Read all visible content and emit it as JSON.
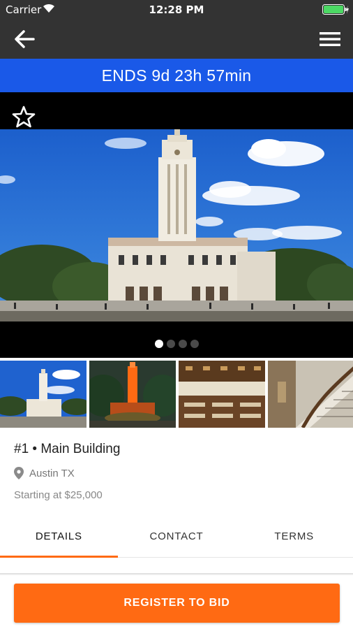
{
  "status_bar": {
    "carrier": "Carrier",
    "time": "12:28 PM",
    "battery_color": "#4cd964"
  },
  "nav": {
    "back_icon": "arrow-left-icon",
    "menu_icon": "hamburger-menu-icon"
  },
  "banner": {
    "text": "ENDS 9d 23h 57min",
    "color": "#1a59e8"
  },
  "gallery": {
    "favorite_icon": "star-outline-icon",
    "page_count": 4,
    "active_page": 1,
    "thumbnails": [
      {
        "name": "tower-day"
      },
      {
        "name": "tower-night"
      },
      {
        "name": "reading-room"
      },
      {
        "name": "staircase"
      }
    ]
  },
  "listing": {
    "title": "#1 • Main Building",
    "location": "Austin TX",
    "price": "Starting at $25,000"
  },
  "tabs": [
    {
      "label": "DETAILS",
      "active": true
    },
    {
      "label": "CONTACT",
      "active": false
    },
    {
      "label": "TERMS",
      "active": false
    }
  ],
  "cta": {
    "label": "REGISTER TO BID",
    "color": "#ff6a13"
  }
}
